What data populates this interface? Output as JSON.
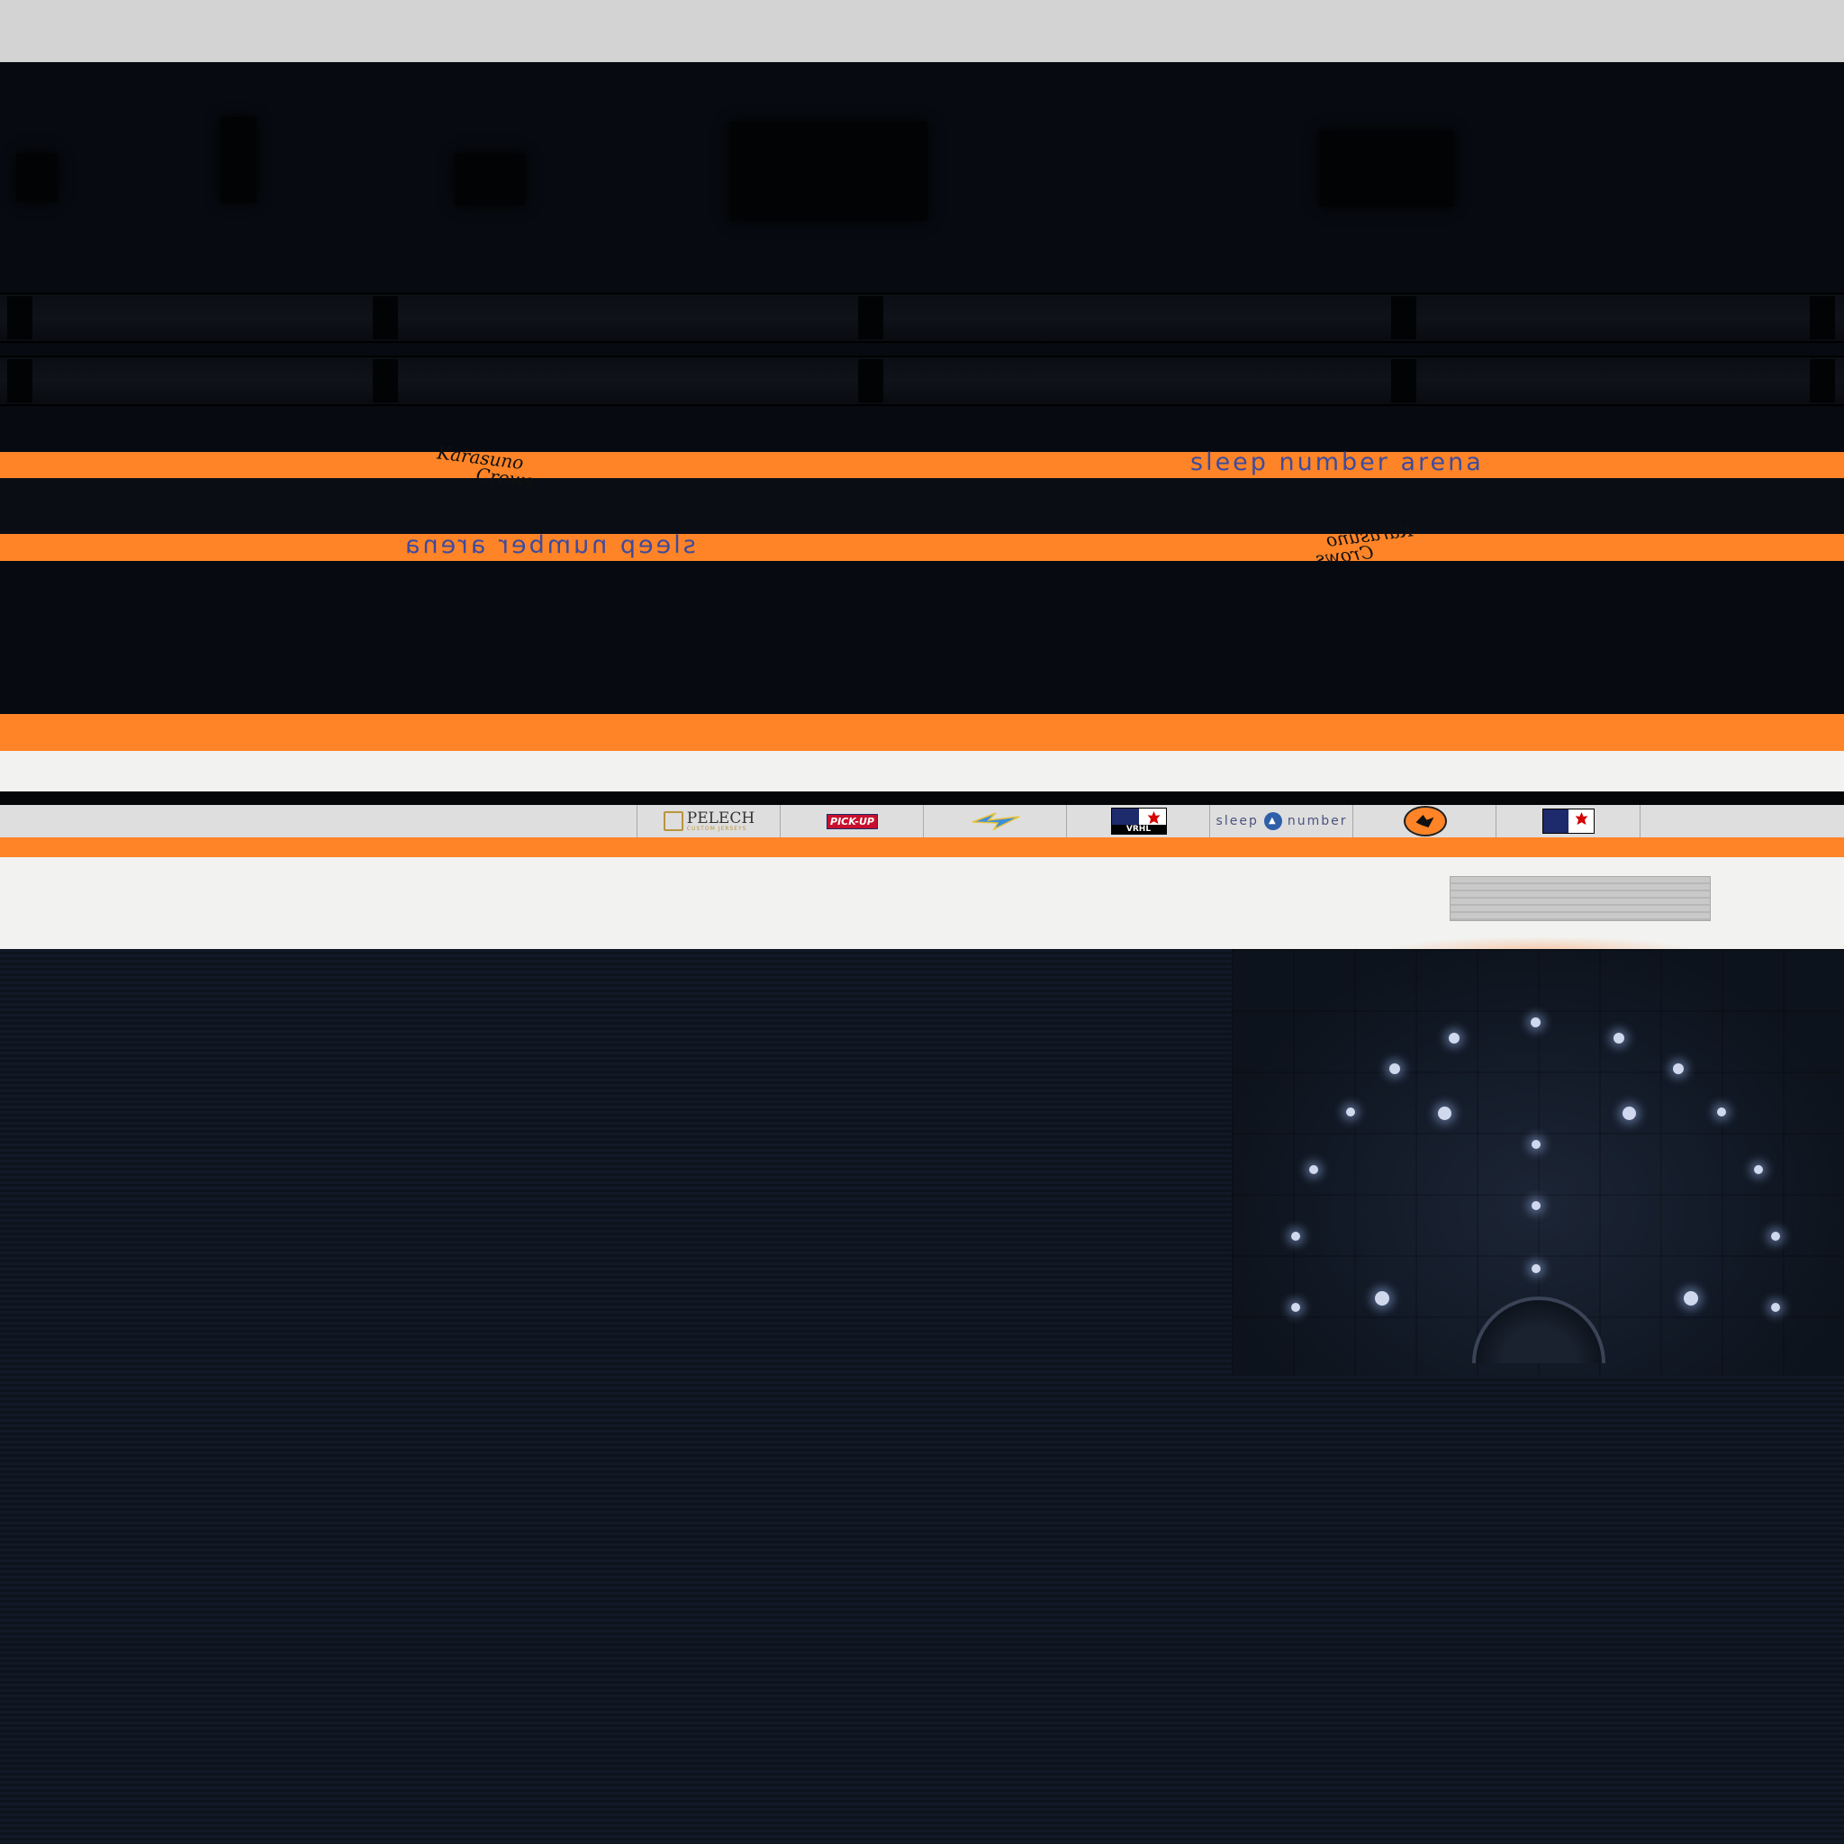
{
  "arena_name": "sleep number arena",
  "team_script": {
    "line1": "Karasuno",
    "line2": "Crows"
  },
  "sponsors": [
    {
      "name": "pelech",
      "title": "PELECH",
      "subtitle": "CUSTOM JERSEYS"
    },
    {
      "name": "pickup",
      "title": "PICK-UP"
    },
    {
      "name": "wings-logo",
      "title": ""
    },
    {
      "name": "vrhl",
      "title": "VRHL"
    },
    {
      "name": "sleep-number",
      "left": "sleep",
      "right": "number"
    },
    {
      "name": "crows-logo",
      "title": ""
    },
    {
      "name": "vrhl-2",
      "title": ""
    }
  ],
  "colors": {
    "orange": "#ff8427",
    "dark": "#070a10",
    "navy": "#121926",
    "arena_text": "#3d4b9e",
    "board_white": "#f2f2f0"
  }
}
